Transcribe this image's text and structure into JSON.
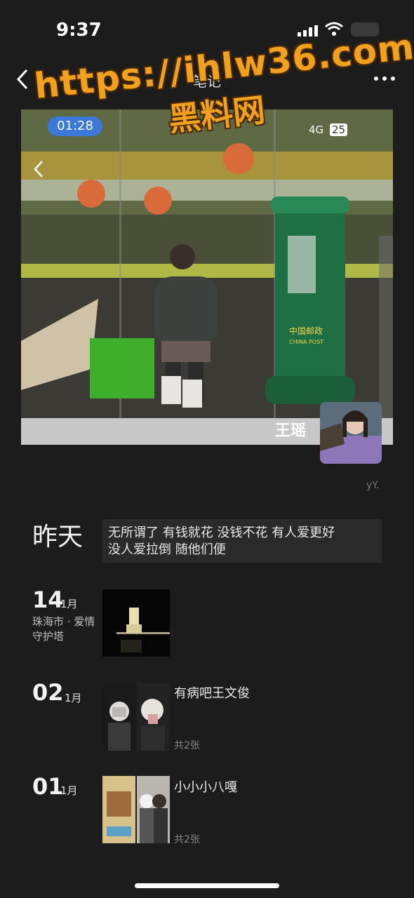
{
  "status_bar": {
    "time": "9:37"
  },
  "nav": {
    "title": "笔记"
  },
  "watermark": {
    "url": "https://ihlw36.com",
    "name": "黑料网"
  },
  "photo": {
    "duration": "01:28",
    "network": "4G",
    "battery": "25",
    "post_brand_cn": "中国邮政",
    "post_brand_en": "CHINA POST",
    "caption_name": "王瑶"
  },
  "signature": "yY.",
  "entries": [
    {
      "date": "昨天",
      "text_line1": "无所谓了 有钱就花 没钱不花 有人爱更好",
      "text_line2": "没人爱拉倒 随他们便"
    },
    {
      "day": "14",
      "month": "1月",
      "location": "珠海市 · 爱情守护塔"
    },
    {
      "day": "02",
      "month": "1月",
      "text": "有病吧王文俊",
      "count": "共2张"
    },
    {
      "day": "01",
      "month": "1月",
      "text": "小小小八嘎",
      "count": "共2张"
    }
  ]
}
